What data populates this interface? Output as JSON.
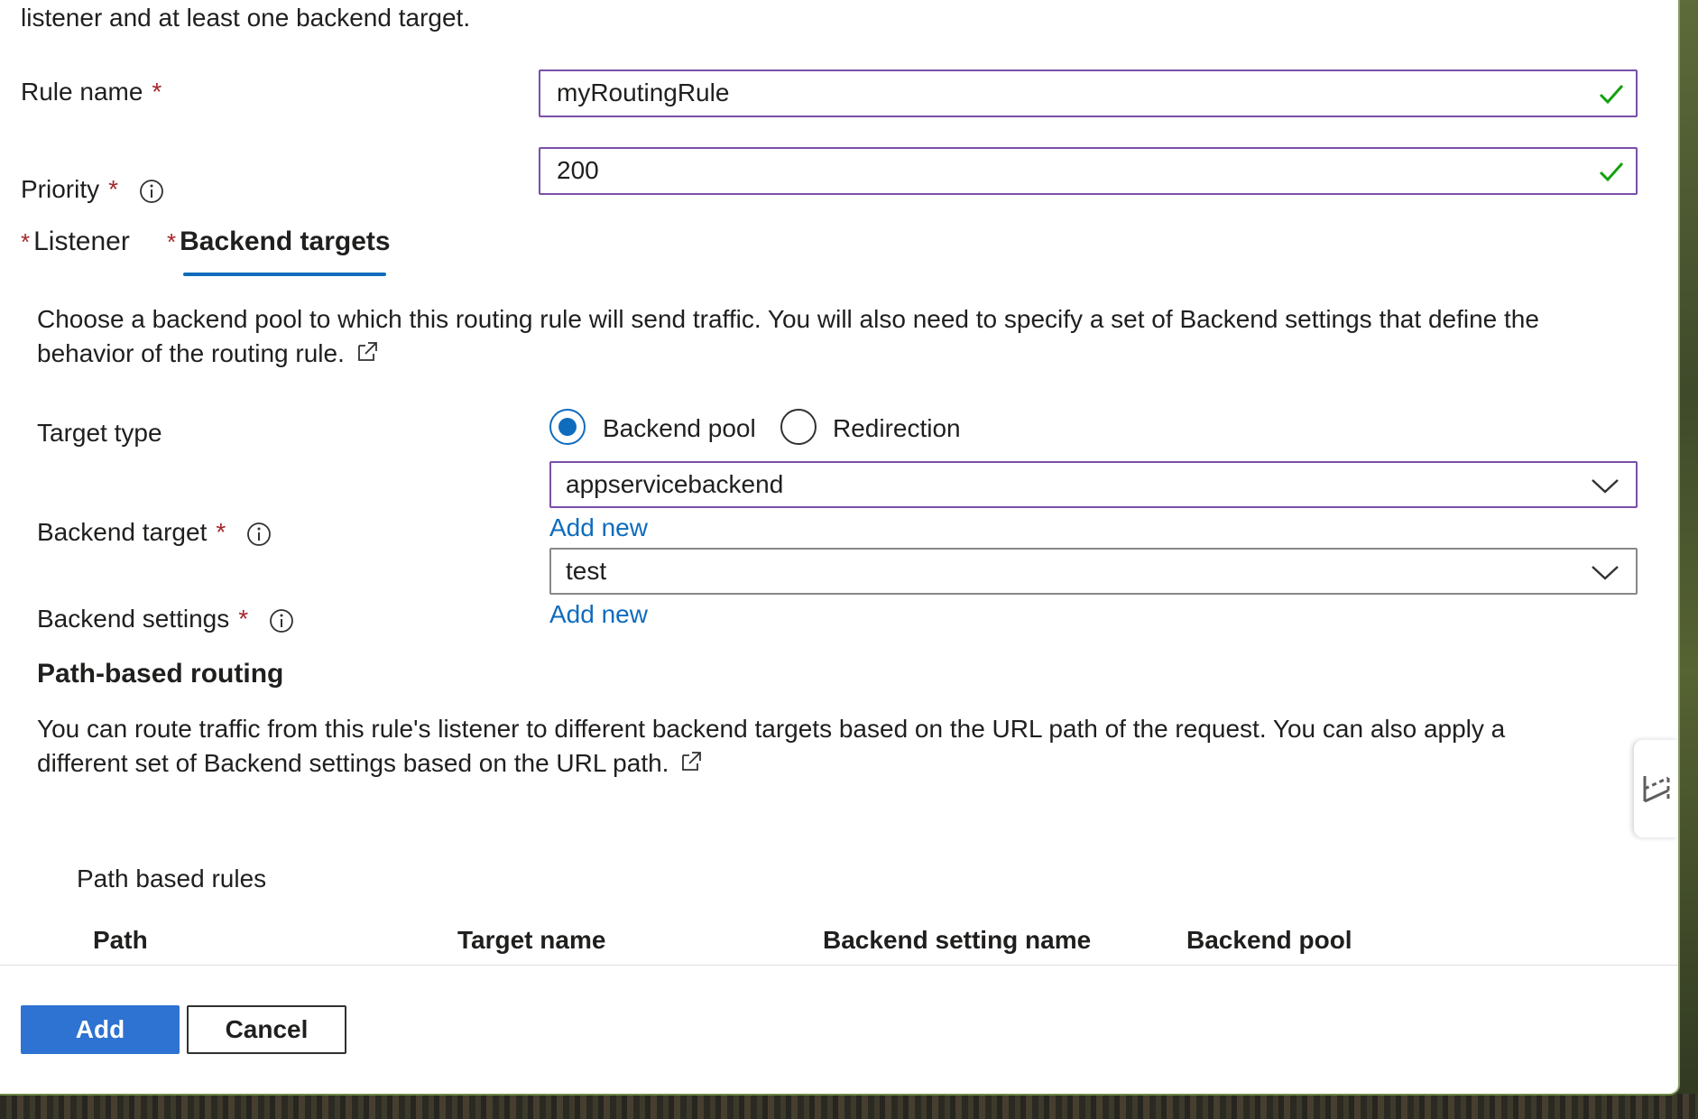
{
  "form": {
    "intro_tail": "listener and at least one backend target.",
    "rule_name": {
      "label": "Rule name",
      "required": "*",
      "value": "myRoutingRule"
    },
    "priority": {
      "label": "Priority",
      "required": "*",
      "value": "200"
    }
  },
  "tabs": [
    {
      "required": "*",
      "label": "Listener",
      "selected": false
    },
    {
      "required": "*",
      "label": "Backend targets",
      "selected": true
    }
  ],
  "backend": {
    "description": "Choose a backend pool to which this routing rule will send traffic. You will also need to specify a set of Backend settings that define the",
    "description_line2": "behavior of the routing rule.",
    "target_type": {
      "label": "Target type",
      "options": [
        "Backend pool",
        "Redirection"
      ],
      "selected": "Backend pool"
    },
    "backend_target": {
      "label": "Backend target",
      "required": "*",
      "value": "appservicebackend",
      "add_new": "Add new"
    },
    "backend_settings": {
      "label": "Backend settings",
      "required": "*",
      "value": "test",
      "add_new": "Add new"
    }
  },
  "path_routing": {
    "heading": "Path-based routing",
    "description": "You can route traffic from this rule's listener to different backend targets based on the URL path of the request. You can also apply a",
    "description_line2": "different set of Backend settings based on the URL path.",
    "rules_title": "Path based rules",
    "columns": [
      "Path",
      "Target name",
      "Backend setting name",
      "Backend pool"
    ]
  },
  "footer": {
    "add_label": "Add",
    "cancel_label": "Cancel"
  },
  "icons": {
    "info": "info-icon",
    "valid": "checkmark-icon",
    "dropdown": "chevron-down-icon",
    "external": "external-link-icon",
    "side_panel": "panel-toggle-icon"
  },
  "colors": {
    "accent": "#0f6cbd",
    "field_border_focus": "#7a4fa8",
    "required": "#a4262c",
    "valid": "#13a10e",
    "primary_button": "#2e72d2"
  }
}
